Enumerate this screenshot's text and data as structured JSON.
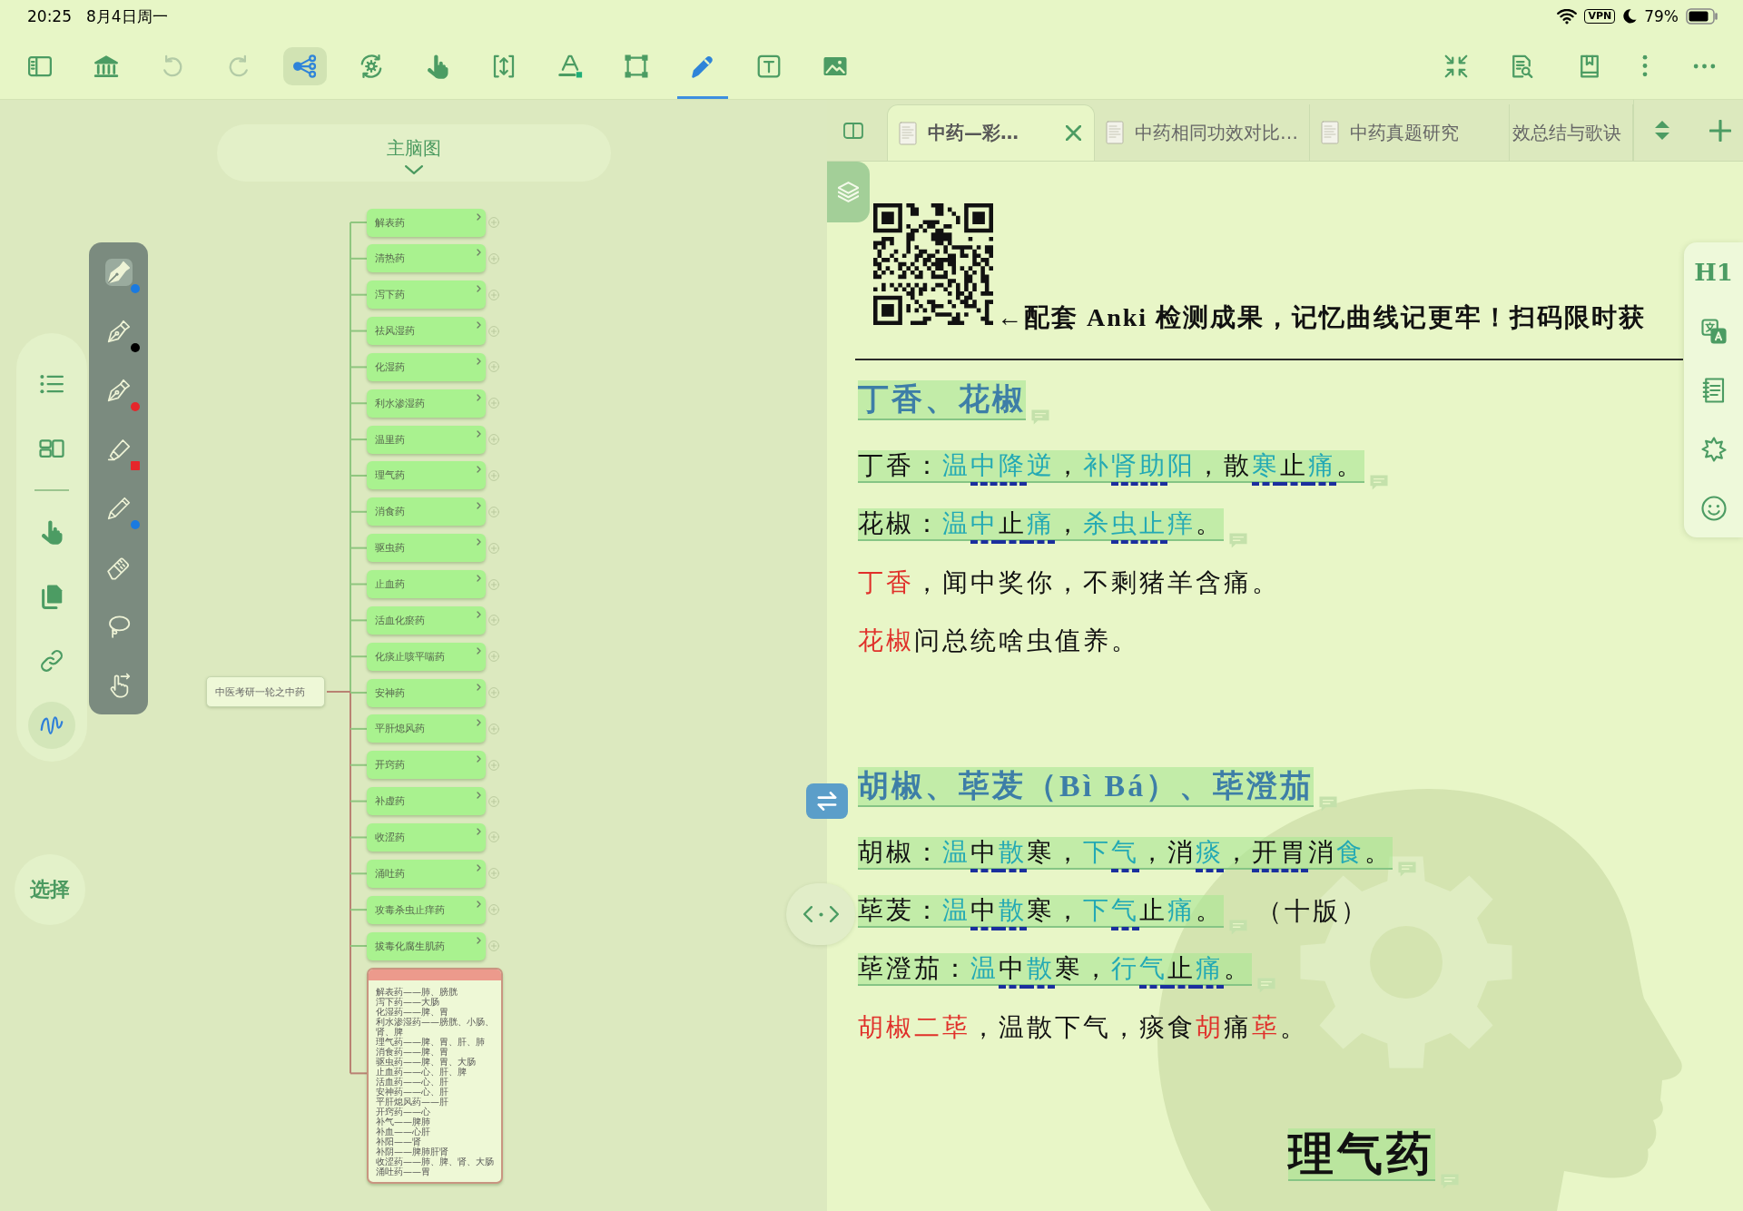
{
  "status_bar": {
    "time": "20:25",
    "date": "8月4日周一",
    "vpn": "VPN",
    "battery": "79%"
  },
  "toolbar": {
    "left": [
      {
        "on": false,
        "selected": false,
        "disabled": false
      },
      {
        "on": false,
        "selected": false,
        "disabled": false
      },
      {
        "on": false,
        "selected": false,
        "disabled": true
      },
      {
        "on": false,
        "selected": false,
        "disabled": true
      },
      {
        "on": true,
        "selected": false,
        "disabled": false
      },
      {
        "on": false,
        "selected": false,
        "disabled": false
      },
      {
        "on": false,
        "selected": false,
        "disabled": false
      },
      {
        "on": false,
        "selected": false,
        "disabled": false
      },
      {
        "on": false,
        "selected": false,
        "disabled": false
      },
      {
        "on": false,
        "selected": false,
        "disabled": false
      },
      {
        "on": false,
        "selected": true,
        "disabled": false
      },
      {
        "on": false,
        "selected": false,
        "disabled": false
      },
      {
        "on": false,
        "selected": false,
        "disabled": false
      }
    ],
    "right": [
      {
        "disabled": false
      },
      {
        "disabled": false
      },
      {
        "disabled": false
      },
      {
        "disabled": false
      },
      {
        "disabled": false
      }
    ]
  },
  "side_toolbar": {
    "top": [
      {
        "selected": false
      },
      {
        "selected": false
      }
    ],
    "bottom": [
      {
        "selected": false
      },
      {
        "selected": false
      },
      {
        "selected": false
      },
      {
        "selected": true
      }
    ]
  },
  "pen_toolbar": [
    {
      "selected": true,
      "color": "#1b7ae0"
    },
    {
      "selected": false,
      "color": "#000000"
    },
    {
      "selected": false,
      "color": "#e5262b"
    },
    {
      "selected": false,
      "color": "#e5262b"
    },
    {
      "selected": false,
      "color": "#1b7ae0"
    },
    {
      "selected": false
    },
    {
      "selected": false
    },
    {
      "selected": false
    }
  ],
  "select_button": "选择",
  "mindmap": {
    "title": "主脑图",
    "root": {
      "label": "中医考研一轮之中药",
      "children": [
        {
          "kind": "topic",
          "label": "解表药",
          "expanded": false,
          "color": "#a9f28f"
        },
        {
          "kind": "topic",
          "label": "清热药",
          "expanded": false,
          "color": "#a9f28f"
        },
        {
          "kind": "topic",
          "label": "泻下药",
          "expanded": false,
          "color": "#a9f28f"
        },
        {
          "kind": "topic",
          "label": "祛风湿药",
          "expanded": false,
          "color": "#a9f28f"
        },
        {
          "kind": "topic",
          "label": "化湿药",
          "expanded": false,
          "color": "#a9f28f"
        },
        {
          "kind": "topic",
          "label": "利水渗湿药",
          "expanded": false,
          "color": "#a9f28f"
        },
        {
          "kind": "topic",
          "label": "温里药",
          "expanded": false,
          "color": "#a9f28f"
        },
        {
          "kind": "topic",
          "label": "理气药",
          "expanded": false,
          "color": "#a9f28f"
        },
        {
          "kind": "topic",
          "label": "消食药",
          "expanded": false,
          "color": "#a9f28f"
        },
        {
          "kind": "topic",
          "label": "驱虫药",
          "expanded": false,
          "color": "#a9f28f"
        },
        {
          "kind": "topic",
          "label": "止血药",
          "expanded": false,
          "color": "#a9f28f"
        },
        {
          "kind": "topic",
          "label": "活血化瘀药",
          "expanded": false,
          "color": "#a9f28f"
        },
        {
          "kind": "topic",
          "label": "化痰止咳平喘药",
          "expanded": false,
          "color": "#a9f28f"
        },
        {
          "kind": "topic",
          "label": "安神药",
          "expanded": false,
          "color": "#a9f28f"
        },
        {
          "kind": "topic",
          "label": "平肝熄风药",
          "expanded": false,
          "color": "#a9f28f"
        },
        {
          "kind": "topic",
          "label": "开窍药",
          "expanded": false,
          "color": "#a9f28f"
        },
        {
          "kind": "topic",
          "label": "补虚药",
          "expanded": false,
          "color": "#a9f28f"
        },
        {
          "kind": "topic",
          "label": "收涩药",
          "expanded": false,
          "color": "#a9f28f"
        },
        {
          "kind": "topic",
          "label": "涌吐药",
          "expanded": false,
          "color": "#a9f28f"
        },
        {
          "kind": "topic",
          "label": "攻毒杀虫止痒药",
          "expanded": false,
          "color": "#a9f28f"
        },
        {
          "kind": "topic",
          "label": "拔毒化腐生肌药",
          "expanded": false,
          "color": "#a9f28f"
        },
        {
          "kind": "note",
          "color": "#ec9a8c",
          "lines": [
            "解表药——肺、膀胱",
            "泻下药——大肠",
            "化湿药——脾、胃",
            "利水渗湿药——膀胱、小肠、肾、脾",
            "理气药——脾、胃、肝、肺",
            "消食药——脾、胃",
            "驱虫药——脾、胃、大肠",
            "止血药——心、肝、脾",
            "活血药——心、肝",
            "安神药——心、肝",
            "平肝熄风药——肝",
            "开窍药——心",
            "补气——脾肺",
            "补血——心肝",
            "补阳——肾",
            "补阴——脾肺肝肾",
            "收涩药——肺、脾、肾、大肠",
            "涌吐药——胃"
          ]
        }
      ]
    }
  },
  "tabs": [
    {
      "label": "中药—彩…",
      "selected": true,
      "clipped": false
    },
    {
      "label": "中药相同功效对比…",
      "selected": false,
      "clipped": false
    },
    {
      "label": "中药真题研究",
      "selected": false,
      "clipped": false
    },
    {
      "label": "效总结与歌诀",
      "selected": false,
      "clipped": true
    }
  ],
  "document": {
    "banner": "←配套 Anki 检测成果，记忆曲线记更牢！扫码限时获",
    "blocks": [
      {
        "kind": "heading",
        "text": "丁香、花椒",
        "highlight": true,
        "note": true
      },
      {
        "kind": "line",
        "highlight": true,
        "note": true,
        "segments": [
          {
            "text": "丁香：",
            "kind": "plain",
            "dash": false
          },
          {
            "text": "温",
            "kind": "key",
            "dash": false
          },
          {
            "text": "中降",
            "kind": "key",
            "dash": true
          },
          {
            "text": "逆",
            "kind": "key",
            "dash": false
          },
          {
            "text": "，",
            "kind": "plain",
            "dash": false
          },
          {
            "text": "补",
            "kind": "key",
            "dash": false
          },
          {
            "text": "肾助",
            "kind": "key",
            "dash": true
          },
          {
            "text": "阳",
            "kind": "key",
            "dash": false
          },
          {
            "text": "，散",
            "kind": "plain",
            "dash": false
          },
          {
            "text": "寒",
            "kind": "key",
            "dash": true
          },
          {
            "text": "止",
            "kind": "plain",
            "dash": true
          },
          {
            "text": "痛",
            "kind": "key",
            "dash": true
          },
          {
            "text": "。",
            "kind": "plain",
            "dash": false
          }
        ]
      },
      {
        "kind": "line",
        "highlight": true,
        "note": true,
        "segments": [
          {
            "text": "花椒：",
            "kind": "plain",
            "dash": false
          },
          {
            "text": "温",
            "kind": "key",
            "dash": false
          },
          {
            "text": "中",
            "kind": "key",
            "dash": true
          },
          {
            "text": "止",
            "kind": "plain",
            "dash": true
          },
          {
            "text": "痛",
            "kind": "key",
            "dash": true
          },
          {
            "text": "，",
            "kind": "plain",
            "dash": false
          },
          {
            "text": "杀",
            "kind": "key",
            "dash": false
          },
          {
            "text": "虫止",
            "kind": "key",
            "dash": true
          },
          {
            "text": "痒",
            "kind": "key",
            "dash": false
          },
          {
            "text": "。",
            "kind": "plain",
            "dash": false
          }
        ]
      },
      {
        "kind": "line",
        "highlight": false,
        "note": false,
        "segments": [
          {
            "text": "丁香",
            "kind": "red",
            "dash": false
          },
          {
            "text": "，闻中奖你，不剩猪羊含痛。",
            "kind": "plain",
            "dash": false
          }
        ]
      },
      {
        "kind": "line",
        "highlight": false,
        "note": false,
        "segments": [
          {
            "text": "花椒",
            "kind": "red",
            "dash": false
          },
          {
            "text": "问总统啥虫值养。",
            "kind": "plain",
            "dash": false
          }
        ]
      },
      {
        "kind": "heading",
        "text": "胡椒、荜茇（Bì Bá）、荜澄茄",
        "highlight": true,
        "note": true
      },
      {
        "kind": "line",
        "highlight": true,
        "note": true,
        "segments": [
          {
            "text": "胡椒：",
            "kind": "plain",
            "dash": false
          },
          {
            "text": "温",
            "kind": "key",
            "dash": false
          },
          {
            "text": "中",
            "kind": "plain",
            "dash": true
          },
          {
            "text": "散",
            "kind": "key",
            "dash": true
          },
          {
            "text": "寒，",
            "kind": "plain",
            "dash": false
          },
          {
            "text": "下",
            "kind": "key",
            "dash": false
          },
          {
            "text": "气",
            "kind": "key",
            "dash": true
          },
          {
            "text": "，消",
            "kind": "plain",
            "dash": false
          },
          {
            "text": "痰",
            "kind": "key",
            "dash": true
          },
          {
            "text": "，",
            "kind": "plain",
            "dash": false
          },
          {
            "text": "开胃",
            "kind": "plain",
            "dash": true
          },
          {
            "text": "消",
            "kind": "plain",
            "dash": false
          },
          {
            "text": "食",
            "kind": "key",
            "dash": false
          },
          {
            "text": "。",
            "kind": "plain",
            "dash": false
          }
        ]
      },
      {
        "kind": "line",
        "highlight": true,
        "note": true,
        "suffix": "（十版）",
        "segments": [
          {
            "text": "荜茇：",
            "kind": "plain",
            "dash": false
          },
          {
            "text": "温",
            "kind": "key",
            "dash": false
          },
          {
            "text": "中",
            "kind": "plain",
            "dash": true
          },
          {
            "text": "散",
            "kind": "key",
            "dash": true
          },
          {
            "text": "寒，",
            "kind": "plain",
            "dash": false
          },
          {
            "text": "下",
            "kind": "key",
            "dash": false
          },
          {
            "text": "气",
            "kind": "key",
            "dash": true
          },
          {
            "text": "止",
            "kind": "plain",
            "dash": false
          },
          {
            "text": "痛",
            "kind": "key",
            "dash": false
          },
          {
            "text": "。",
            "kind": "plain",
            "dash": false
          }
        ]
      },
      {
        "kind": "line",
        "highlight": true,
        "note": true,
        "segments": [
          {
            "text": "荜澄茄：",
            "kind": "plain",
            "dash": false
          },
          {
            "text": "温",
            "kind": "key",
            "dash": false
          },
          {
            "text": "中",
            "kind": "plain",
            "dash": true
          },
          {
            "text": "散",
            "kind": "key",
            "dash": true
          },
          {
            "text": "寒，",
            "kind": "plain",
            "dash": false
          },
          {
            "text": "行",
            "kind": "key",
            "dash": false
          },
          {
            "text": "气",
            "kind": "key",
            "dash": true
          },
          {
            "text": "止",
            "kind": "plain",
            "dash": true
          },
          {
            "text": "痛",
            "kind": "key",
            "dash": true
          },
          {
            "text": "。",
            "kind": "plain",
            "dash": false
          }
        ]
      },
      {
        "kind": "line",
        "highlight": false,
        "note": false,
        "segments": [
          {
            "text": "胡椒二荜",
            "kind": "red",
            "dash": false
          },
          {
            "text": "，温散下气，痰食",
            "kind": "plain",
            "dash": false
          },
          {
            "text": "胡",
            "kind": "red",
            "dash": false
          },
          {
            "text": "痛",
            "kind": "plain",
            "dash": false
          },
          {
            "text": "荜",
            "kind": "red",
            "dash": false
          },
          {
            "text": "。",
            "kind": "plain",
            "dash": false
          }
        ]
      },
      {
        "kind": "title",
        "text": "理气药",
        "highlight": true,
        "note": true
      }
    ]
  },
  "format_panel": {
    "heading_button": "H1"
  }
}
